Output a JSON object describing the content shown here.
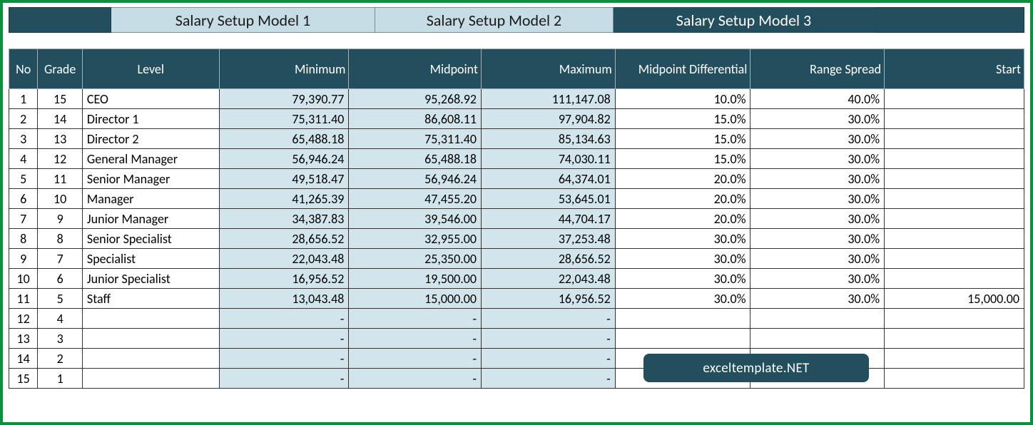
{
  "tabs": {
    "tab1": "Salary Setup Model 1",
    "tab2": "Salary Setup Model 2",
    "tab3": "Salary Setup Model 3"
  },
  "headers": {
    "no": "No",
    "grade": "Grade",
    "level": "Level",
    "minimum": "Minimum",
    "midpoint": "Midpoint",
    "maximum": "Maximum",
    "midpoint_diff": "Midpoint Differential",
    "range_spread": "Range Spread",
    "start": "Start"
  },
  "rows": [
    {
      "no": "1",
      "grade": "15",
      "level": "CEO",
      "min": "79,390.77",
      "mid": "95,268.92",
      "max": "111,147.08",
      "diff": "10.0%",
      "spread": "40.0%",
      "start": ""
    },
    {
      "no": "2",
      "grade": "14",
      "level": "Director 1",
      "min": "75,311.40",
      "mid": "86,608.11",
      "max": "97,904.82",
      "diff": "15.0%",
      "spread": "30.0%",
      "start": ""
    },
    {
      "no": "3",
      "grade": "13",
      "level": "Director 2",
      "min": "65,488.18",
      "mid": "75,311.40",
      "max": "85,134.63",
      "diff": "15.0%",
      "spread": "30.0%",
      "start": ""
    },
    {
      "no": "4",
      "grade": "12",
      "level": "General Manager",
      "min": "56,946.24",
      "mid": "65,488.18",
      "max": "74,030.11",
      "diff": "15.0%",
      "spread": "30.0%",
      "start": ""
    },
    {
      "no": "5",
      "grade": "11",
      "level": "Senior Manager",
      "min": "49,518.47",
      "mid": "56,946.24",
      "max": "64,374.01",
      "diff": "20.0%",
      "spread": "30.0%",
      "start": ""
    },
    {
      "no": "6",
      "grade": "10",
      "level": "Manager",
      "min": "41,265.39",
      "mid": "47,455.20",
      "max": "53,645.01",
      "diff": "20.0%",
      "spread": "30.0%",
      "start": ""
    },
    {
      "no": "7",
      "grade": "9",
      "level": "Junior Manager",
      "min": "34,387.83",
      "mid": "39,546.00",
      "max": "44,704.17",
      "diff": "20.0%",
      "spread": "30.0%",
      "start": ""
    },
    {
      "no": "8",
      "grade": "8",
      "level": "Senior Specialist",
      "min": "28,656.52",
      "mid": "32,955.00",
      "max": "37,253.48",
      "diff": "30.0%",
      "spread": "30.0%",
      "start": ""
    },
    {
      "no": "9",
      "grade": "7",
      "level": "Specialist",
      "min": "22,043.48",
      "mid": "25,350.00",
      "max": "28,656.52",
      "diff": "30.0%",
      "spread": "30.0%",
      "start": ""
    },
    {
      "no": "10",
      "grade": "6",
      "level": "Junior Specialist",
      "min": "16,956.52",
      "mid": "19,500.00",
      "max": "22,043.48",
      "diff": "30.0%",
      "spread": "30.0%",
      "start": ""
    },
    {
      "no": "11",
      "grade": "5",
      "level": "Staff",
      "min": "13,043.48",
      "mid": "15,000.00",
      "max": "16,956.52",
      "diff": "30.0%",
      "spread": "30.0%",
      "start": "15,000.00"
    },
    {
      "no": "12",
      "grade": "4",
      "level": "",
      "min": "-",
      "mid": "-",
      "max": "-",
      "diff": "",
      "spread": "",
      "start": ""
    },
    {
      "no": "13",
      "grade": "3",
      "level": "",
      "min": "-",
      "mid": "-",
      "max": "-",
      "diff": "",
      "spread": "",
      "start": ""
    },
    {
      "no": "14",
      "grade": "2",
      "level": "",
      "min": "-",
      "mid": "-",
      "max": "-",
      "diff": "",
      "spread": "",
      "start": ""
    },
    {
      "no": "15",
      "grade": "1",
      "level": "",
      "min": "-",
      "mid": "-",
      "max": "-",
      "diff": "",
      "spread": "",
      "start": ""
    }
  ],
  "watermark": "exceltemplate.NET"
}
